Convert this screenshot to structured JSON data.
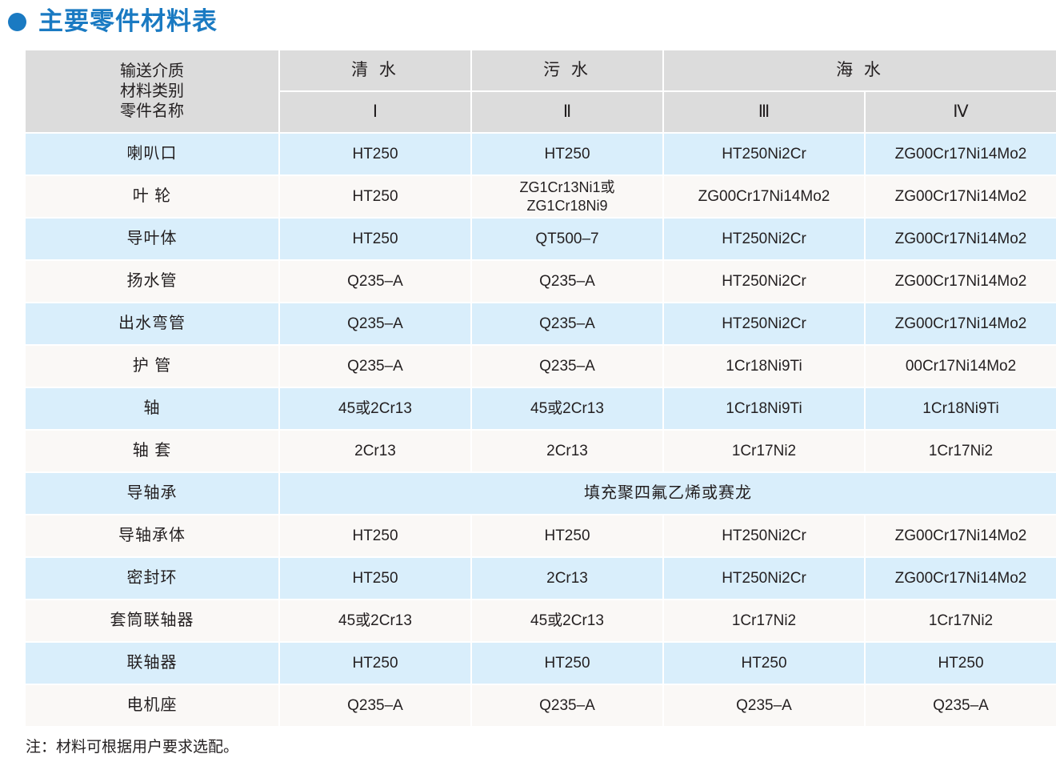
{
  "title": {
    "text": "主要零件材料表",
    "bullet_icon": "bullet-dot",
    "color": "#1a7ac2"
  },
  "table": {
    "header": {
      "corner": {
        "line1": "输送介质",
        "line2": "材料类别",
        "line3": "零件名称"
      },
      "media": [
        {
          "label": "清 水",
          "span": 1
        },
        {
          "label": "污 水",
          "span": 1
        },
        {
          "label": "海 水",
          "span": 2
        }
      ],
      "classes": [
        "Ⅰ",
        "Ⅱ",
        "Ⅲ",
        "Ⅳ"
      ]
    },
    "rows": [
      {
        "part": "喇叭口",
        "cells": [
          "HT250",
          "HT250",
          "HT250Ni2Cr",
          "ZG00Cr17Ni14Mo2"
        ]
      },
      {
        "part": "叶 轮",
        "cells": [
          "HT250",
          "ZG1Cr13Ni1或\nZG1Cr18Ni9",
          "ZG00Cr17Ni14Mo2",
          "ZG00Cr17Ni14Mo2"
        ]
      },
      {
        "part": "导叶体",
        "cells": [
          "HT250",
          "QT500–7",
          "HT250Ni2Cr",
          "ZG00Cr17Ni14Mo2"
        ]
      },
      {
        "part": "扬水管",
        "cells": [
          "Q235–A",
          "Q235–A",
          "HT250Ni2Cr",
          "ZG00Cr17Ni14Mo2"
        ]
      },
      {
        "part": "出水弯管",
        "cells": [
          "Q235–A",
          "Q235–A",
          "HT250Ni2Cr",
          "ZG00Cr17Ni14Mo2"
        ]
      },
      {
        "part": "护 管",
        "cells": [
          "Q235–A",
          "Q235–A",
          "1Cr18Ni9Ti",
          "00Cr17Ni14Mo2"
        ]
      },
      {
        "part": "轴",
        "cells": [
          "45或2Cr13",
          "45或2Cr13",
          "1Cr18Ni9Ti",
          "1Cr18Ni9Ti"
        ]
      },
      {
        "part": "轴 套",
        "cells": [
          "2Cr13",
          "2Cr13",
          "1Cr17Ni2",
          "1Cr17Ni2"
        ]
      },
      {
        "part": "导轴承",
        "merged_cell": "填充聚四氟乙烯或赛龙"
      },
      {
        "part": "导轴承体",
        "cells": [
          "HT250",
          "HT250",
          "HT250Ni2Cr",
          "ZG00Cr17Ni14Mo2"
        ]
      },
      {
        "part": "密封环",
        "cells": [
          "HT250",
          "2Cr13",
          "HT250Ni2Cr",
          "ZG00Cr17Ni14Mo2"
        ]
      },
      {
        "part": "套筒联轴器",
        "cells": [
          "45或2Cr13",
          "45或2Cr13",
          "1Cr17Ni2",
          "1Cr17Ni2"
        ]
      },
      {
        "part": "联轴器",
        "cells": [
          "HT250",
          "HT250",
          "HT250",
          "HT250"
        ]
      },
      {
        "part": "电机座",
        "cells": [
          "Q235–A",
          "Q235–A",
          "Q235–A",
          "Q235–A"
        ]
      }
    ]
  },
  "note": "注：材料可根据用户要求选配。",
  "colors": {
    "accent": "#1a7ac2",
    "header_bg": "#dcdcdc",
    "row_odd_bg": "#d9eefb",
    "row_even_bg": "#faf8f6",
    "text": "#231f20"
  }
}
